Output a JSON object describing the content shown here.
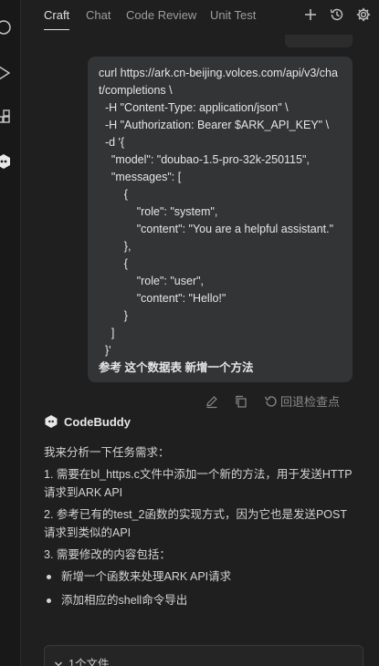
{
  "tabs": [
    {
      "label": "Craft",
      "active": true
    },
    {
      "label": "Chat",
      "active": false
    },
    {
      "label": "Code Review",
      "active": false
    },
    {
      "label": "Unit Test",
      "active": false
    }
  ],
  "header_icons": [
    "plus-icon",
    "history-icon",
    "gear-icon"
  ],
  "activity_icons": [
    "circle-icon",
    "play-icon",
    "extensions-icon",
    "codebuddy-icon"
  ],
  "user_message": {
    "code": "curl https://ark.cn-beijing.volces.com/api/v3/chat/completions \\\n  -H \"Content-Type: application/json\" \\\n  -H \"Authorization: Bearer $ARK_API_KEY\" \\\n  -d '{\n    \"model\": \"doubao-1.5-pro-32k-250115\",\n    \"messages\": [\n        {\n            \"role\": \"system\",\n            \"content\": \"You are a helpful assistant.\"\n        },\n        {\n            \"role\": \"user\",\n            \"content\": \"Hello!\"\n        }\n    ]\n  }'",
    "prompt": "参考 这个数据表 新增一个方法"
  },
  "message_actions": {
    "edit_icon": "edit-icon",
    "copy_icon": "copy-icon",
    "revert_icon": "revert-icon",
    "checkpoint_label": "回退检查点"
  },
  "assistant": {
    "name": "CodeBuddy",
    "intro": "我来分析一下任务需求：",
    "steps": [
      "1. 需要在bl_https.c文件中添加一个新的方法，用于发送HTTP请求到ARK API",
      "2. 参考已有的test_2函数的实现方式，因为它也是发送POST请求到类似的API",
      "3. 需要修改的内容包括："
    ],
    "bullets": [
      "新增一个函数来处理ARK API请求",
      "添加相应的shell命令导出"
    ]
  },
  "file_panel": {
    "label": "1个文件"
  },
  "colors": {
    "background": "#1f1f1f",
    "bubble": "#333436",
    "text": "#e6e6e6",
    "muted": "#8a8a8a"
  }
}
